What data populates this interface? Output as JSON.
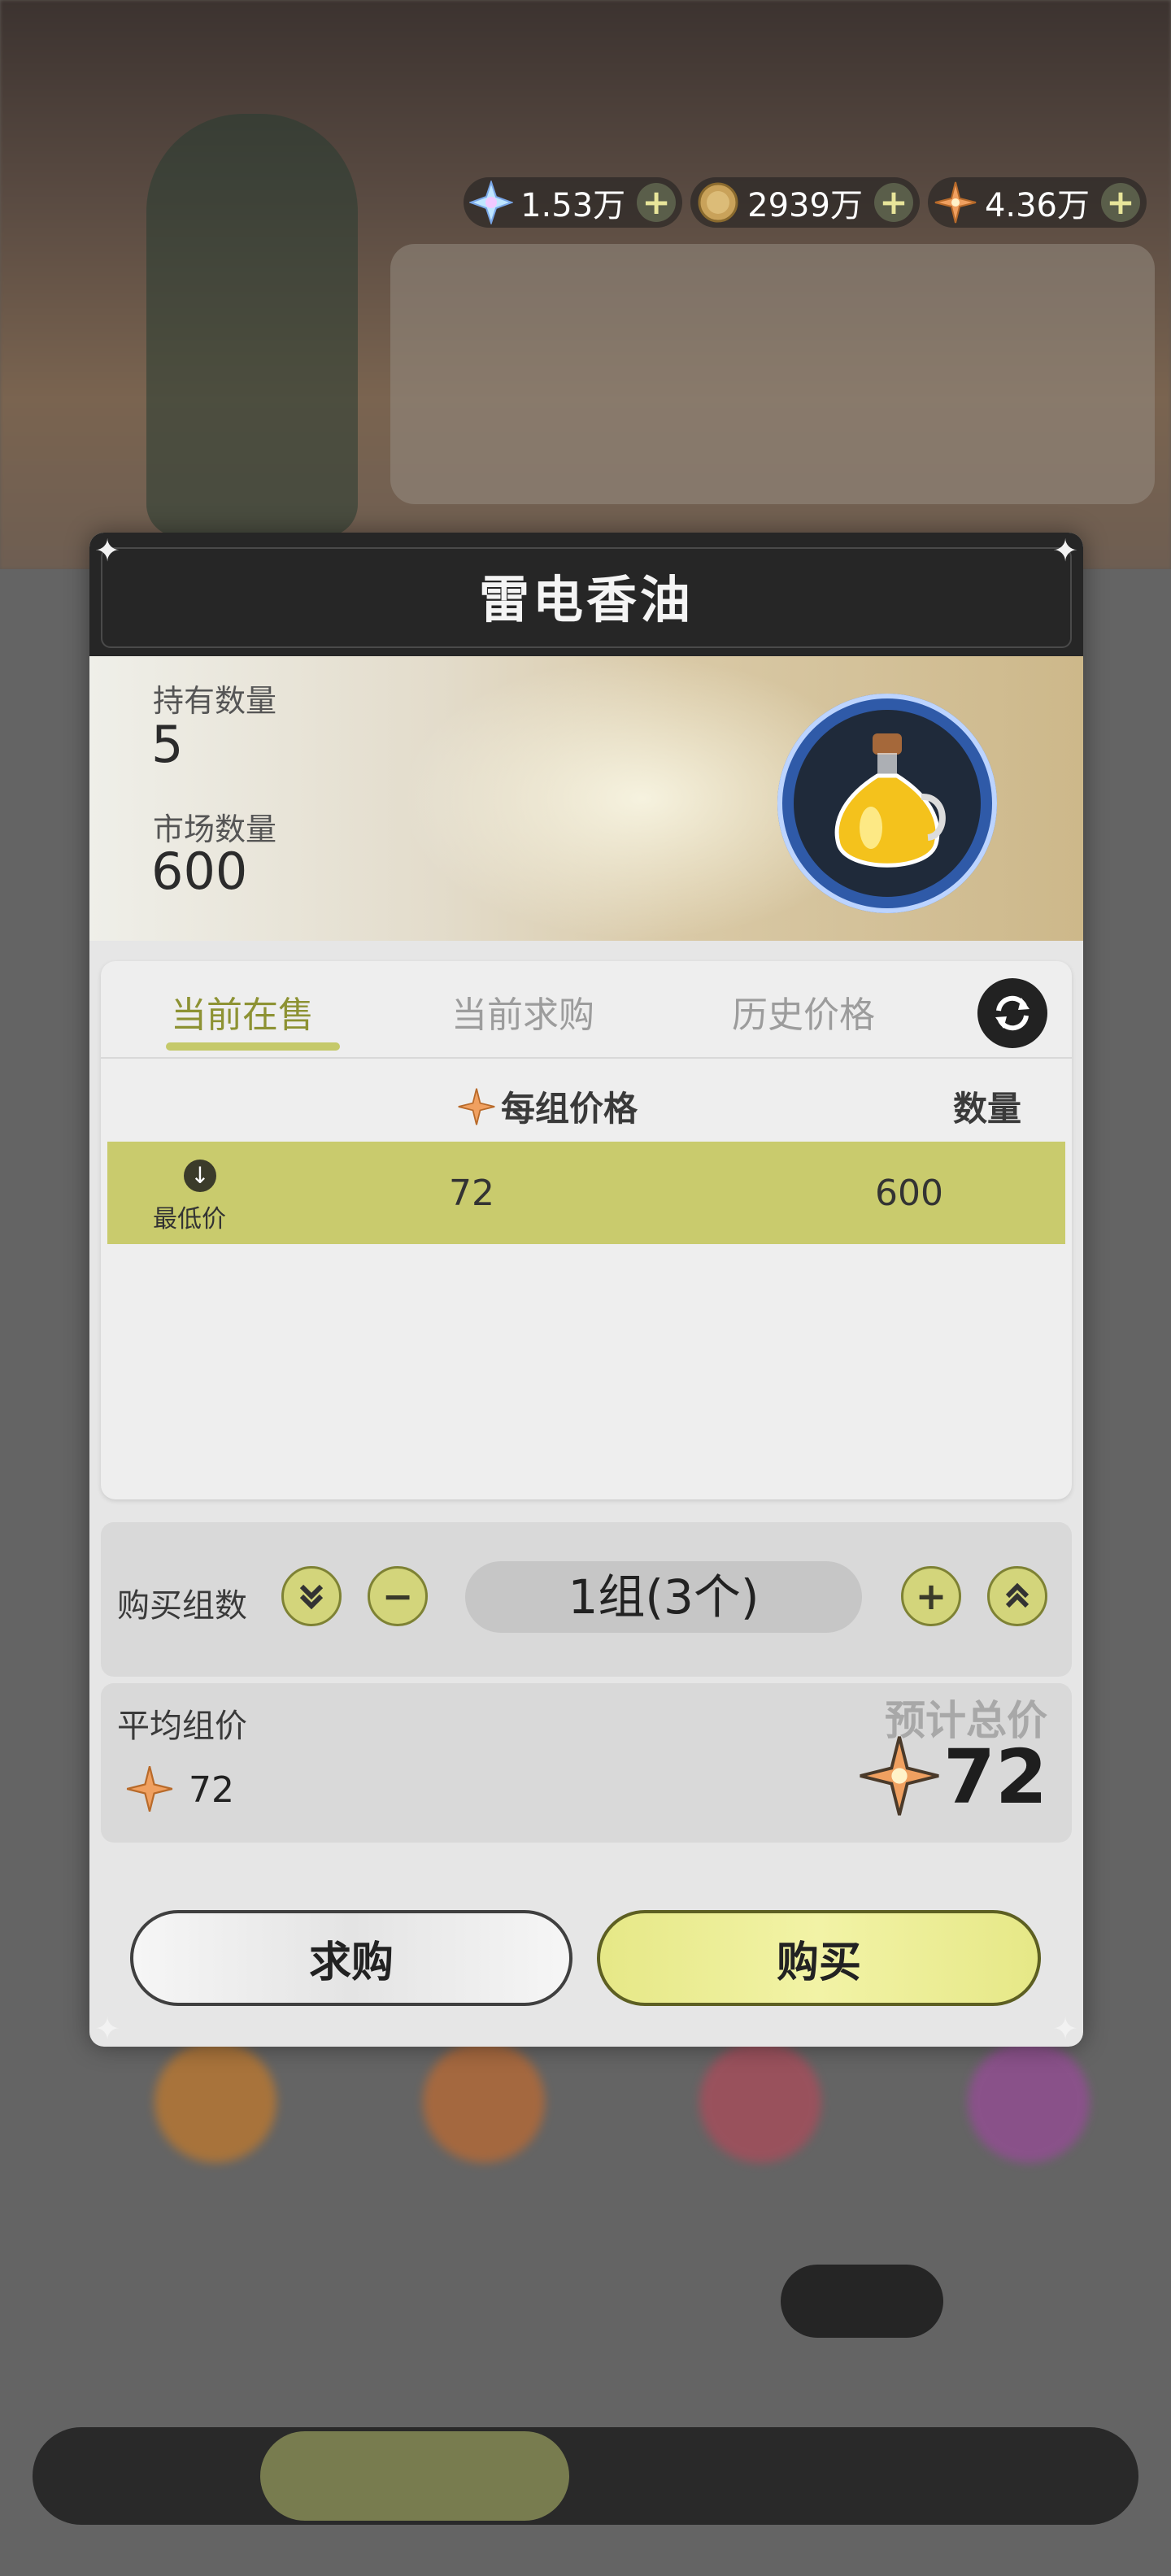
{
  "currency": [
    {
      "icon": "crystal-icon",
      "value": "1.53万"
    },
    {
      "icon": "coin-icon",
      "value": "2939万"
    },
    {
      "icon": "star-shard-icon",
      "value": "4.36万"
    }
  ],
  "dialog": {
    "title": "雷电香油",
    "held_label": "持有数量",
    "held_value": "5",
    "market_label": "市场数量",
    "market_value": "600",
    "item_icon": "oil-bottle-icon"
  },
  "tabs": [
    {
      "label": "当前在售",
      "active": true
    },
    {
      "label": "当前求购",
      "active": false
    },
    {
      "label": "历史价格",
      "active": false
    }
  ],
  "table": {
    "col_price": "每组价格",
    "col_qty": "数量",
    "rows": [
      {
        "tag": "最低价",
        "price": "72",
        "qty": "600"
      }
    ]
  },
  "purchase": {
    "groups_label": "购买组数",
    "groups_value": "1组(3个)",
    "avg_label": "平均组价",
    "avg_value": "72",
    "total_label": "预计总价",
    "total_value": "72"
  },
  "buttons": {
    "request": "求购",
    "buy": "购买"
  },
  "colors": {
    "accent": "#c9cb6d",
    "title_bar": "#262626",
    "item_frame": "#2f5aa8"
  }
}
